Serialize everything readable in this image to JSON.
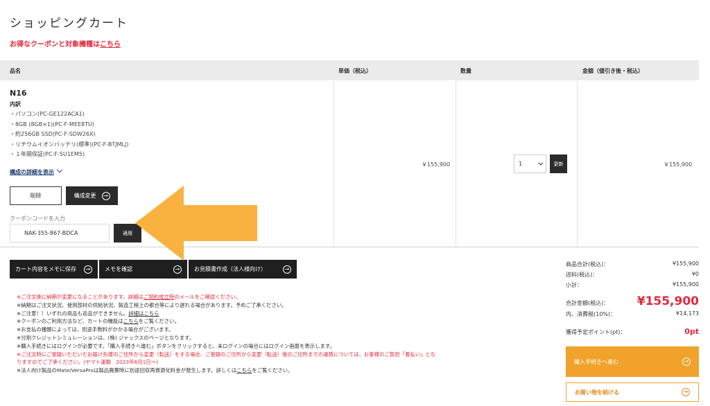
{
  "page": {
    "title": "ショッピングカート",
    "promo_prefix": "お得なクーポンと対象機種は",
    "promo_link": "こちら"
  },
  "table": {
    "headers": [
      "品名",
      "単価（税込）",
      "数量",
      "金額（値引き後・税込）"
    ]
  },
  "item": {
    "name": "N16",
    "breakdown_label": "内訳",
    "specs": [
      "・パソコン(PC-GE122ACA1)",
      "・8GB (8GB×1)(PC-F-MEE8TU)",
      "・約256GB SSD(PC-F-SDW26X)",
      "・リチウムイオンバッテリ(標準)(PC-F-BTJMLJ)",
      "・１年間保証(PC-F-SU1EM5)"
    ],
    "detail_link": "構成の詳細を表示",
    "delete_label": "削除",
    "config_label": "構成変更",
    "unit_price": "￥155,900",
    "quantity": "1",
    "update_label": "更新",
    "line_amount": "￥155,900"
  },
  "coupon": {
    "label": "クーポンコードを入力",
    "value": "NAK-355-867-BDCA",
    "apply_label": "適用"
  },
  "actions": {
    "save_memo": "カート内容をメモに保存",
    "check_memo": "メモを確認",
    "quote": "お見積書作成（法人様向け）"
  },
  "notes": {
    "n1_pre": "※ご注文後に納期が変更になることがあります。詳細は",
    "n1_link": "ご契約成立時",
    "n1_post": "のメールをご確認ください。",
    "n2": "※納期はご注文状況、使用部材の供給状況、製造工程上の都合等により遅れる場合があります。予めご了承ください。",
    "n3_pre": "※ご注意！）いずれの商品も返品ができません。",
    "n3_link": "詳細はこちら",
    "n4_pre": "※クーポンのご利用方法など、カートの機能は",
    "n4_link": "こちら",
    "n4_post": "をご覧ください。",
    "n5": "※お支払の種類によっては、別途手数料がかかる場合がございます。",
    "n6": "※分割クレジットシミュレーションは、(株) ジャックスのページとなります。",
    "n7": "※購入手続きにはログインが必要です。「購入手続きへ進む」ボタンをクリックすると、未ログインの場合にはログイン画面を表示します。",
    "n8": "※ご注文時にご登録いただいたお届け先様のご住所から変更（転送）をする場合、ご登録のご住所から変更（転送）後のご住所までの運賃については、お客様のご負担「着払い」とな",
    "n9": "りますのでご了承ください。(ヤマト運輸　2023年6月1日〜)",
    "n10_pre": "※法人向け製品のMate/VersaProは製品廃棄時に別途回収再資源化料金が発生します。詳しくは",
    "n10_link": "こちら",
    "n10_post": "をご覧ください。"
  },
  "summary": {
    "subtotal_label": "商品合計(税込)：",
    "subtotal_value": "¥155,900",
    "shipping_label": "送料(税込)：",
    "shipping_value": "¥0",
    "small_total_label": "小計：",
    "small_total_value": "¥155,900",
    "total_label": "合計金額(税込)：",
    "total_value": "¥155,900",
    "tax_label": "内、消費税(10%)：",
    "tax_value": "¥14,173",
    "points_label": "獲得予定ポイント(pt)：",
    "points_value": "0pt",
    "checkout_label": "購入手続きへ進む",
    "continue_label": "お買い物を続ける"
  },
  "colors": {
    "accent_red": "#e5283a",
    "checkout_orange": "#f0a22a",
    "overlay_arrow": "#f9b23f",
    "dark_button": "#1f1f1f"
  }
}
